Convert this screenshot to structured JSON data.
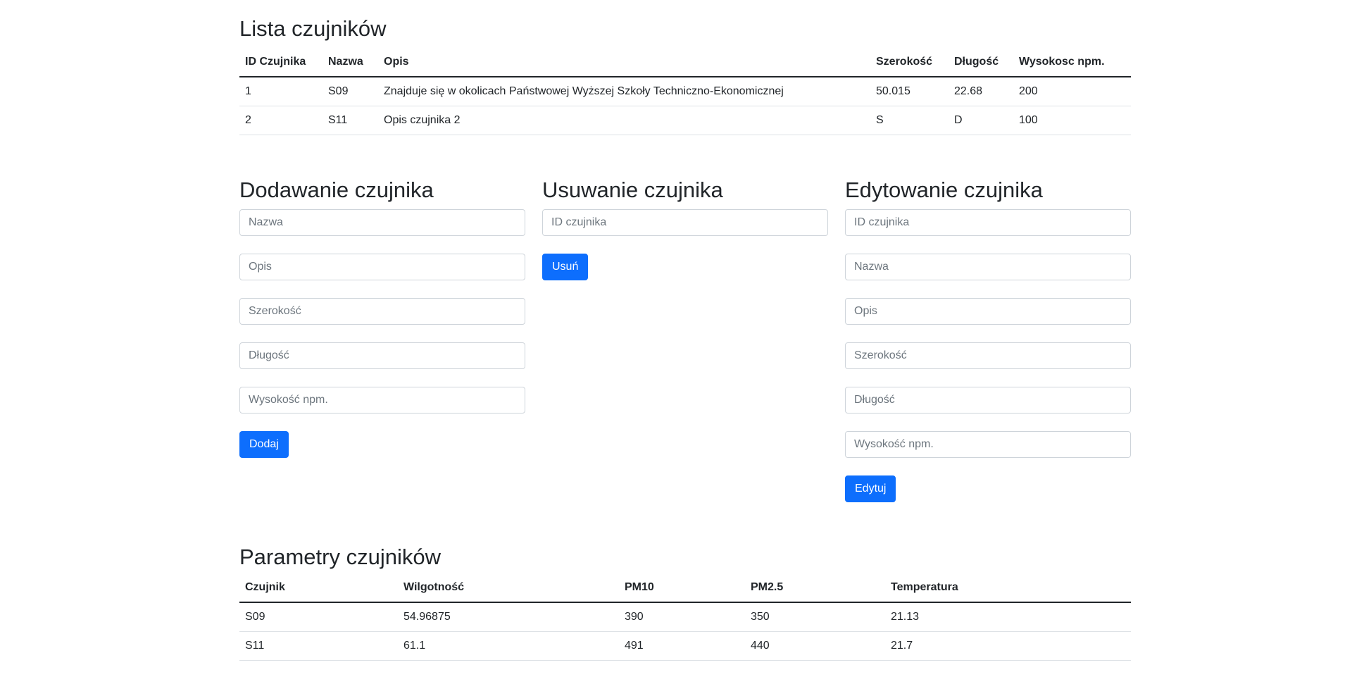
{
  "sensors_list": {
    "title": "Lista czujników",
    "columns": [
      "ID Czujnika",
      "Nazwa",
      "Opis",
      "Szerokość",
      "Długość",
      "Wysokosc npm."
    ],
    "rows": [
      [
        "1",
        "S09",
        "Znajduje się w okolicach Państwowej Wyższej Szkoły Techniczno-Ekonomicznej",
        "50.015",
        "22.68",
        "200"
      ],
      [
        "2",
        "S11",
        "Opis czujnika 2",
        "S",
        "D",
        "100"
      ]
    ]
  },
  "add_form": {
    "title": "Dodawanie czujnika",
    "placeholders": {
      "name": "Nazwa",
      "description": "Opis",
      "latitude": "Szerokość",
      "longitude": "Długość",
      "altitude": "Wysokość npm."
    },
    "button_label": "Dodaj"
  },
  "delete_form": {
    "title": "Usuwanie czujnika",
    "placeholders": {
      "id": "ID czujnika"
    },
    "button_label": "Usuń"
  },
  "edit_form": {
    "title": "Edytowanie czujnika",
    "placeholders": {
      "id": "ID czujnika",
      "name": "Nazwa",
      "description": "Opis",
      "latitude": "Szerokość",
      "longitude": "Długość",
      "altitude": "Wysokość npm."
    },
    "button_label": "Edytuj"
  },
  "params_list": {
    "title": "Parametry czujników",
    "columns": [
      "Czujnik",
      "Wilgotność",
      "PM10",
      "PM2.5",
      "Temperatura"
    ],
    "rows": [
      [
        "S09",
        "54.96875",
        "390",
        "350",
        "21.13"
      ],
      [
        "S11",
        "61.1",
        "491",
        "440",
        "21.7"
      ]
    ]
  },
  "colors": {
    "primary_button": "#0d6efd",
    "text": "#212529",
    "input_border": "#ced4da",
    "row_border": "#dee2e6"
  }
}
